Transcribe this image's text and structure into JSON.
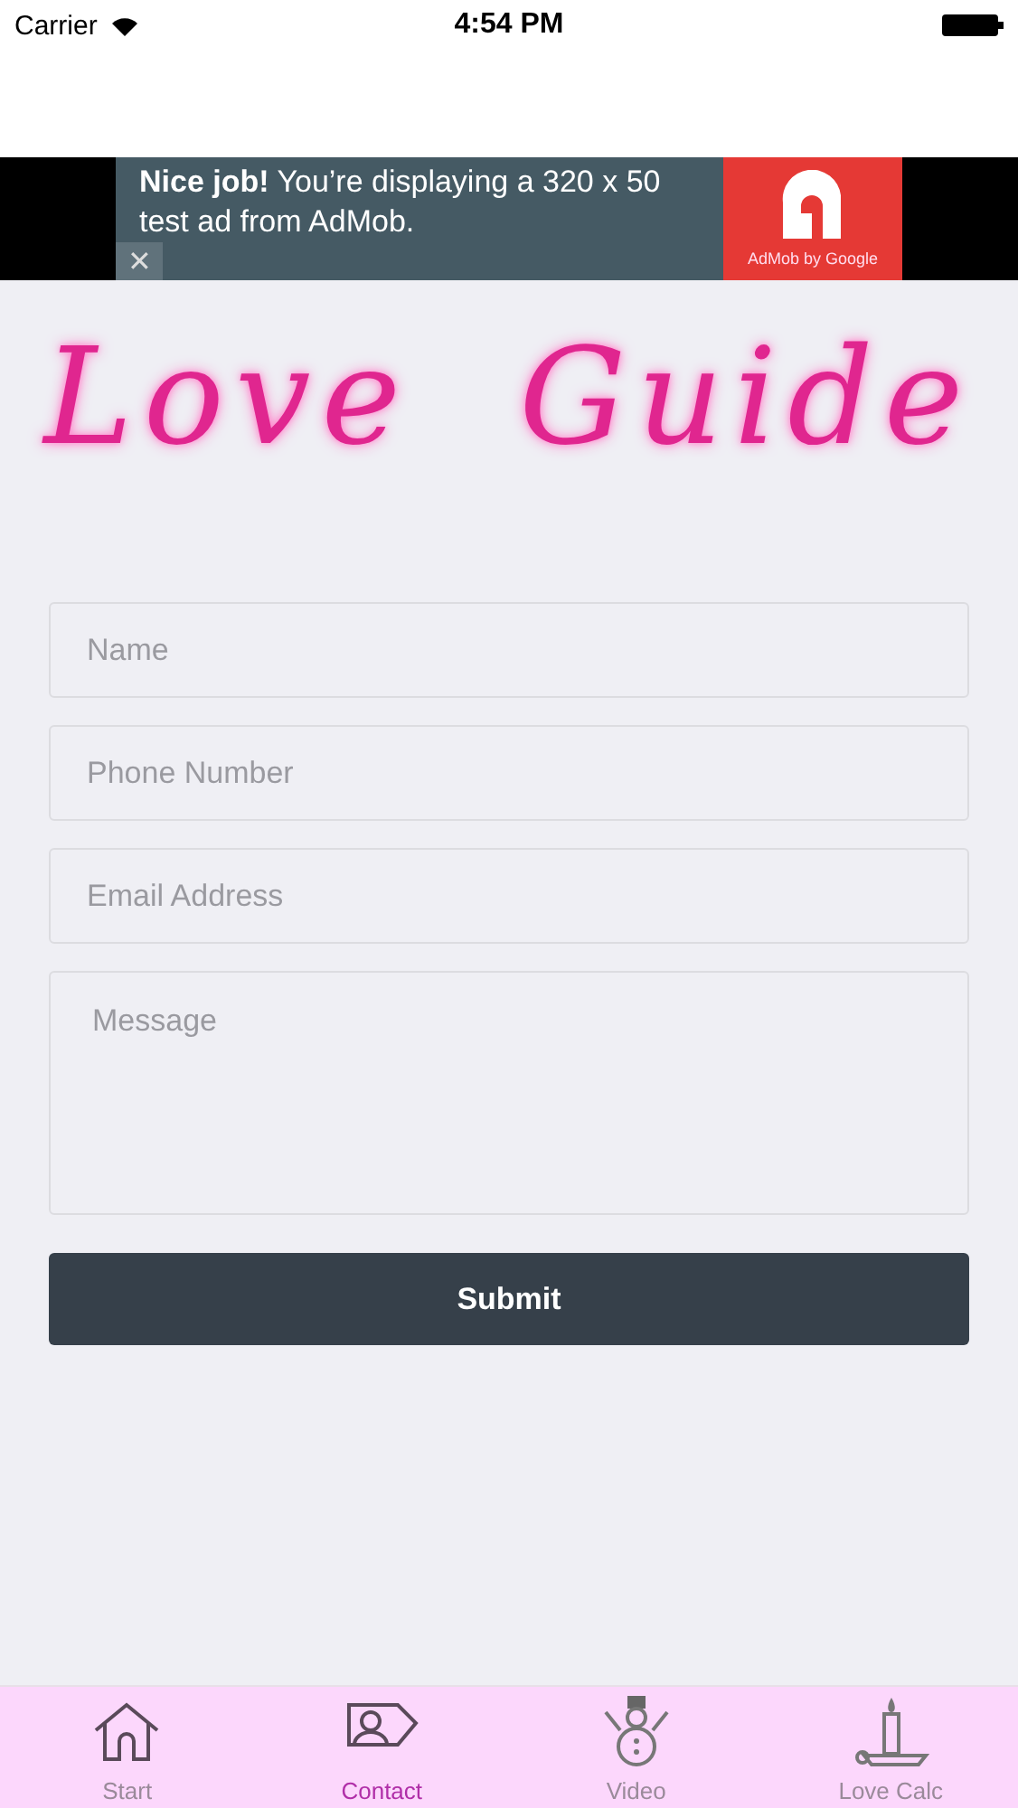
{
  "status_bar": {
    "carrier": "Carrier",
    "time": "4:54 PM"
  },
  "ad": {
    "text": "**Nice job!** You’re displaying a 320 x 50 test ad from AdMob.",
    "brand": "AdMob by Google",
    "close": "✕"
  },
  "logo": {
    "title": "Love Guide"
  },
  "form": {
    "fields": [
      {
        "kind": "input",
        "placeholder": "Name"
      },
      {
        "kind": "input",
        "placeholder": "Phone Number"
      },
      {
        "kind": "input",
        "placeholder": "Email Address"
      },
      {
        "kind": "textarea",
        "placeholder": "Message"
      }
    ],
    "submit": "Submit"
  },
  "tabs": [
    {
      "label": "Start",
      "selected": false
    },
    {
      "label": "Contact",
      "selected": true
    },
    {
      "label": "Video",
      "selected": false
    },
    {
      "label": "Love Calc",
      "selected": false
    }
  ]
}
